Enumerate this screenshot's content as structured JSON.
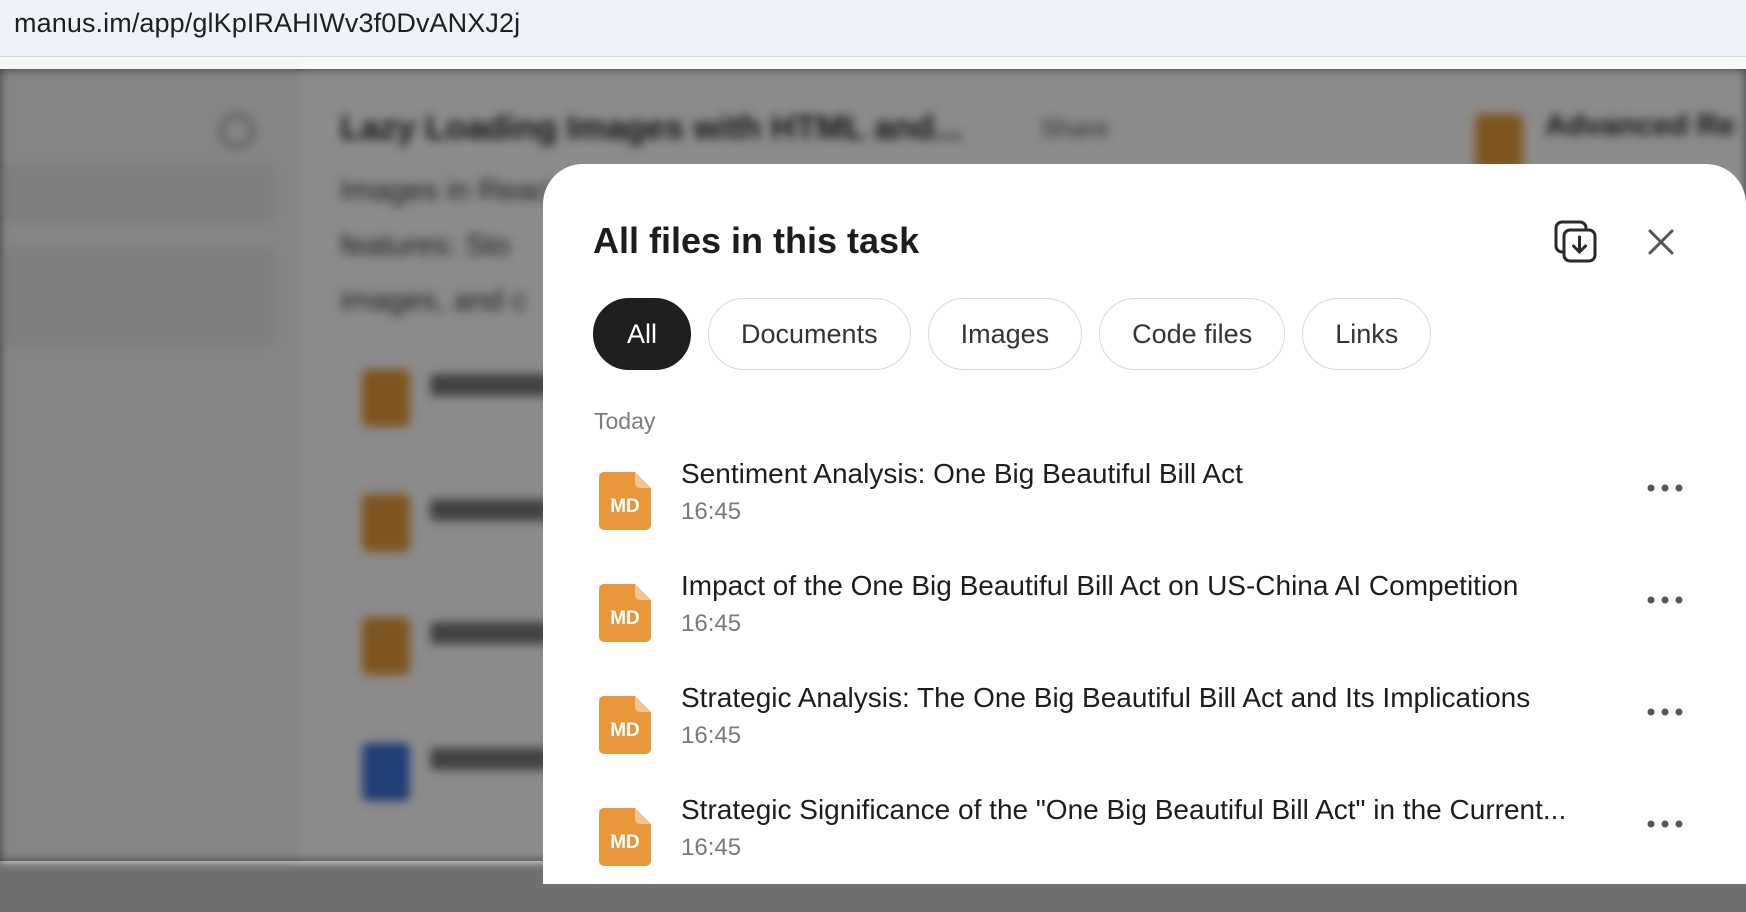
{
  "browser": {
    "url": "manus.im/app/glKpIRAHIWv3f0DvANXJ2j"
  },
  "modal": {
    "title": "All files in this task",
    "filters": [
      {
        "label": "All",
        "active": true
      },
      {
        "label": "Documents",
        "active": false
      },
      {
        "label": "Images",
        "active": false
      },
      {
        "label": "Code files",
        "active": false
      },
      {
        "label": "Links",
        "active": false
      }
    ],
    "section_label": "Today",
    "files": [
      {
        "name": "Sentiment Analysis: One Big Beautiful Bill Act",
        "time": "16:45",
        "type": "MD"
      },
      {
        "name": "Impact of the One Big Beautiful Bill Act on US-China AI Competition",
        "time": "16:45",
        "type": "MD"
      },
      {
        "name": "Strategic Analysis: The One Big Beautiful Bill Act and Its Implications",
        "time": "16:45",
        "type": "MD"
      },
      {
        "name": "Strategic Significance of the \"One Big Beautiful Bill Act\" in the Current...",
        "time": "16:45",
        "type": "MD"
      }
    ]
  },
  "colors": {
    "md_icon": "#e8973a",
    "active_chip": "#1f1f1f"
  }
}
